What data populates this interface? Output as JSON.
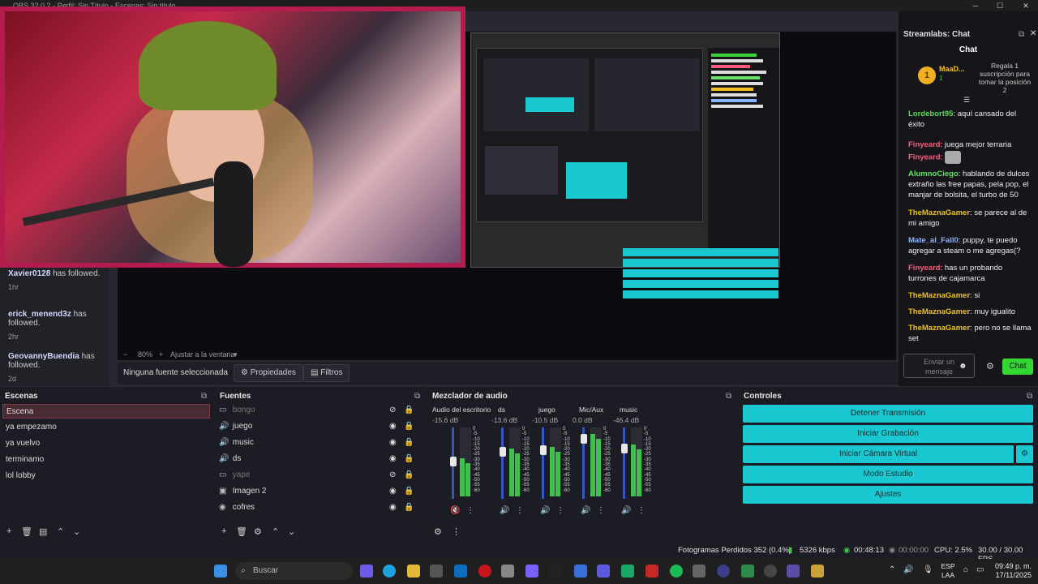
{
  "window": {
    "title": "OBS 32.0.2 - Perfil: Sin Título - Escenas: Sin título"
  },
  "preview": {
    "zoom": "80%",
    "fit": "Ajustar a la ventana",
    "no_source": "Ninguna fuente seleccionada",
    "properties_label": "Propiedades",
    "filters_label": "Filtros"
  },
  "follows": [
    {
      "name": "Xavier0128",
      "text": "has followed.",
      "time": "1hr"
    },
    {
      "name": "erick_menend3z",
      "text": "has followed.",
      "time": "2hr"
    },
    {
      "name": "GeovannyBuendia",
      "text": "has followed.",
      "time": "2d"
    }
  ],
  "chat": {
    "dock_title": "Streamlabs: Chat",
    "title": "Chat",
    "top_user": "MaaD...",
    "top_rank": "1",
    "top_count": "1",
    "promo": "Regala 1 suscripción para tomar la posición 2",
    "messages": [
      {
        "user": "Lordebort95",
        "color": "#4ee04e",
        "text": "aquí cansado del éxito"
      },
      {
        "user": "Finyeard",
        "color": "#ff5a7a",
        "text": "juega mejor terraria"
      },
      {
        "user": "Finyeard",
        "color": "#ff5a7a",
        "text": ""
      },
      {
        "user": "AlumnoCiego",
        "color": "#66e066",
        "text": "hablando de dulces extraño las free papas, pela pop, el manjar de bolsita, el turbo de 50"
      },
      {
        "user": "TheMaznaGamer",
        "color": "#f0c020",
        "text": "se parece al de mi amigo"
      },
      {
        "user": "Mate_al_Fall0",
        "color": "#8ab4ff",
        "text": "puppy, te puedo agregar a steam o me agregas(?"
      },
      {
        "user": "Finyeard",
        "color": "#ff5a7a",
        "text": "has un probando turrones de cajamarca"
      },
      {
        "user": "TheMaznaGamer",
        "color": "#f0c020",
        "text": "si"
      },
      {
        "user": "TheMaznaGamer",
        "color": "#f0c020",
        "text": "muy igualito"
      },
      {
        "user": "TheMaznaGamer",
        "color": "#f0c020",
        "text": "pero no se llama set"
      }
    ],
    "input_placeholder": "Enviar un mensaje",
    "send_label": "Chat"
  },
  "scenes": {
    "title": "Escenas",
    "items": [
      "Escena",
      "ya empezamo",
      "ya vuelvo",
      "terminamo",
      "lol lobby"
    ],
    "selected": 0
  },
  "sources": {
    "title": "Fuentes",
    "items": [
      {
        "name": "bongo",
        "icon": "window-capture-icon",
        "visible": false
      },
      {
        "name": "juego",
        "icon": "audio-icon",
        "visible": true
      },
      {
        "name": "music",
        "icon": "audio-icon",
        "visible": true
      },
      {
        "name": "ds",
        "icon": "audio-icon",
        "visible": true
      },
      {
        "name": "yape",
        "icon": "window-capture-icon",
        "visible": false
      },
      {
        "name": "Imagen 2",
        "icon": "image-icon",
        "visible": true
      },
      {
        "name": "cofres",
        "icon": "media-icon",
        "visible": true
      }
    ]
  },
  "mixer": {
    "title": "Mezclador de audio",
    "channels": [
      {
        "name": "Audio del escritorio",
        "db": "-15.6 dB",
        "level": 0.55,
        "muted": true
      },
      {
        "name": "ds",
        "db": "-13.6 dB",
        "level": 0.7,
        "muted": false
      },
      {
        "name": "juego",
        "db": "-10.5 dB",
        "level": 0.72,
        "muted": false
      },
      {
        "name": "Mic/Aux",
        "db": "0.0 dB",
        "level": 0.9,
        "muted": false
      },
      {
        "name": "music",
        "db": "-46.4 dB",
        "level": 0.75,
        "muted": false
      }
    ],
    "scale": [
      "0",
      "-5",
      "-10",
      "-15",
      "-20",
      "-25",
      "-30",
      "-35",
      "-40",
      "-45",
      "-50",
      "-55",
      "-60"
    ]
  },
  "controls": {
    "title": "Controles",
    "buttons": [
      "Detener Transmisión",
      "Iniciar Grabación",
      "Iniciar Cámara Virtual",
      "Modo Estudio",
      "Ajustes"
    ]
  },
  "status": {
    "dropped": "Fotogramas Perdidos 352 (0.4%)",
    "bitrate": "5326 kbps",
    "stream_time": "00:48:13",
    "rec_time": "00:00:00",
    "cpu": "CPU: 2.5%",
    "fps": "30.00 / 30.00 FPS"
  },
  "taskbar": {
    "search_placeholder": "Buscar",
    "lang": "ESP",
    "lang_sub": "LAA",
    "time": "09:49 p. m.",
    "date": "17/11/2025"
  },
  "colors": {
    "accent": "#19c8d0",
    "chat_send": "#33d633",
    "webcam_border": "#b31c4c"
  }
}
